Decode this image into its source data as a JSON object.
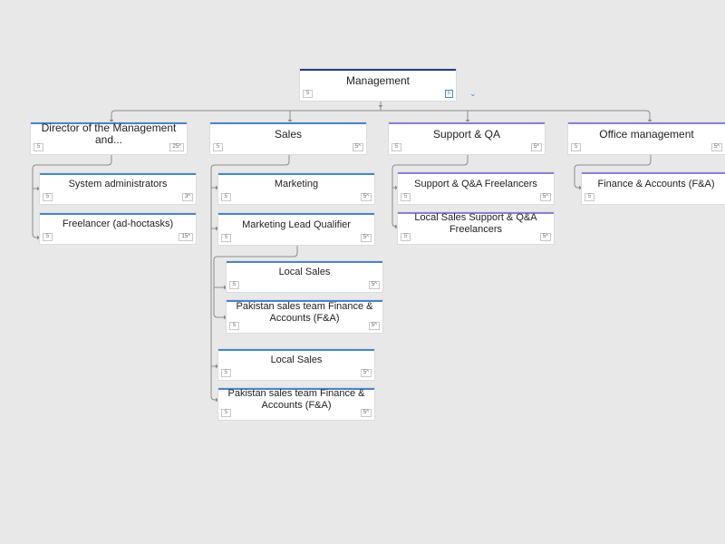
{
  "org_chart": {
    "root": {
      "title": "Management",
      "count": "5",
      "total": "5"
    },
    "root_expand_icon": "chevron-down-icon",
    "collapse_icon": "chevron-up-icon",
    "departments": [
      {
        "title": "Director of the Management and...",
        "count": "5",
        "total": "25",
        "children": [
          {
            "title": "System administrators",
            "count": "5",
            "total": "3"
          },
          {
            "title": "Freelancer (ad-hoctasks)",
            "count": "5",
            "total": "15"
          }
        ]
      },
      {
        "title": "Sales",
        "count": "5",
        "total": "5",
        "children": [
          {
            "title": "Marketing",
            "count": "5",
            "total": "5"
          },
          {
            "title": "Marketing Lead Qualifier",
            "count": "5",
            "total": "5",
            "children": [
              {
                "title": "Local Sales",
                "count": "5",
                "total": "5"
              },
              {
                "title": "Pakistan sales team Finance & Accounts (F&A)",
                "count": "5",
                "total": "5"
              }
            ]
          },
          {
            "title": "Local Sales",
            "count": "5",
            "total": "5"
          },
          {
            "title": "Pakistan sales team Finance & Accounts (F&A)",
            "count": "5",
            "total": "5"
          }
        ]
      },
      {
        "title": "Support & QA",
        "count": "5",
        "total": "5",
        "children": [
          {
            "title": "Support & Q&A Freelancers",
            "count": "5",
            "total": "5"
          },
          {
            "title": "Local Sales Support & Q&A Freelancers",
            "count": "5",
            "total": "5"
          }
        ]
      },
      {
        "title": "Office management",
        "count": "5",
        "total": "5",
        "children": [
          {
            "title": "Finance & Accounts (F&A)",
            "count": "5",
            "total": ""
          }
        ]
      }
    ]
  },
  "colors": {
    "blue_accent": "#4a86c8",
    "violet_accent": "#8a82d6",
    "root_accent": "#253d8a",
    "connector": "#8c8c8c",
    "background": "#e8e8e8"
  }
}
